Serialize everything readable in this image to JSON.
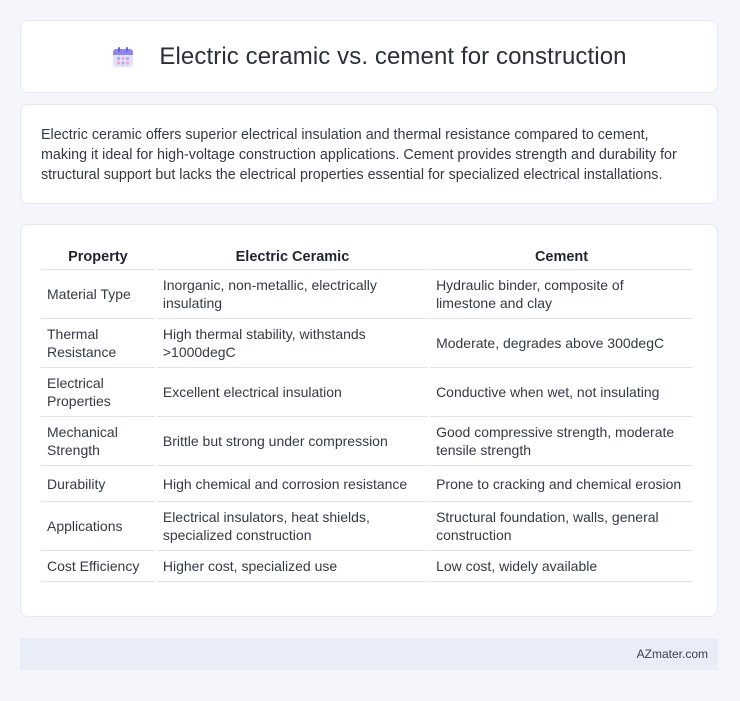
{
  "header": {
    "title": "Electric ceramic vs. cement for construction",
    "icon": "calendar-icon"
  },
  "intro": {
    "text": "Electric ceramic offers superior electrical insulation and thermal resistance compared to cement, making it ideal for high-voltage construction applications. Cement provides strength and durability for structural support but lacks the electrical properties essential for specialized electrical installations."
  },
  "table": {
    "headers": [
      "Property",
      "Electric Ceramic",
      "Cement"
    ],
    "rows": [
      [
        "Material Type",
        "Inorganic, non-metallic, electrically insulating",
        "Hydraulic binder, composite of limestone and clay"
      ],
      [
        "Thermal Resistance",
        "High thermal stability, withstands >1000degC",
        "Moderate, degrades above 300degC"
      ],
      [
        "Electrical Properties",
        "Excellent electrical insulation",
        "Conductive when wet, not insulating"
      ],
      [
        "Mechanical Strength",
        "Brittle but strong under compression",
        "Good compressive strength, moderate tensile strength"
      ],
      [
        "Durability",
        "High chemical and corrosion resistance",
        "Prone to cracking and chemical erosion"
      ],
      [
        "Applications",
        "Electrical insulators, heat shields, specialized construction",
        "Structural foundation, walls, general construction"
      ],
      [
        "Cost Efficiency",
        "Higher cost, specialized use",
        "Low cost, widely available"
      ]
    ]
  },
  "footer": {
    "brand": "AZmater.com"
  }
}
